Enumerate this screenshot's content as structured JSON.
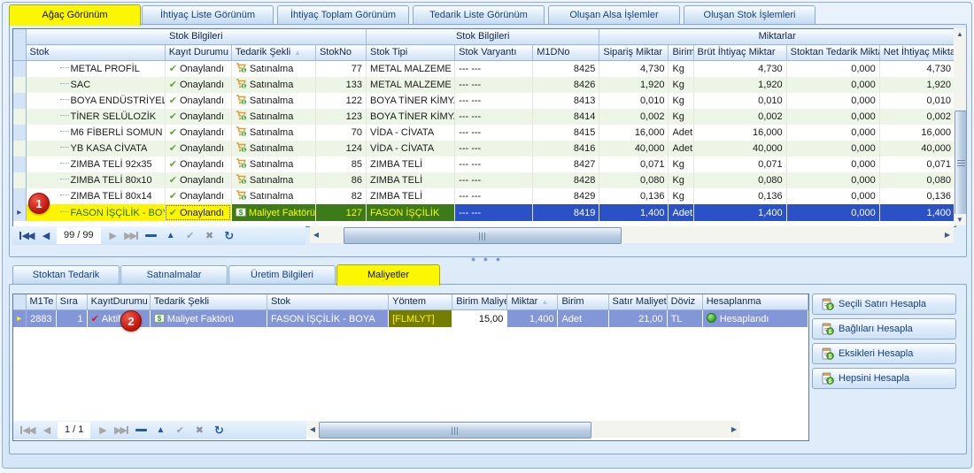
{
  "tabs_top": [
    {
      "label": "Ağaç Görünüm",
      "active": true
    },
    {
      "label": "İhtiyaç Liste Görünüm",
      "active": false
    },
    {
      "label": "İhtiyaç Toplam Görünüm",
      "active": false
    },
    {
      "label": "Tedarik Liste Görünüm",
      "active": false
    },
    {
      "label": "Oluşan Alsa İşlemler",
      "active": false
    },
    {
      "label": "Oluşan Stok İşlemleri",
      "active": false
    }
  ],
  "main_grid": {
    "bands": [
      "Stok Bilgileri",
      "Stok Bilgileri",
      "Miktarlar"
    ],
    "columns": [
      {
        "label": "Stok"
      },
      {
        "label": "Kayıt Durumu"
      },
      {
        "label": "Tedarik Şekli",
        "sorted": true
      },
      {
        "label": "StokNo"
      },
      {
        "label": "Stok Tipi"
      },
      {
        "label": "Stok Varyantı"
      },
      {
        "label": "M1DNo"
      },
      {
        "label": "Sipariş Miktar"
      },
      {
        "label": "Birim"
      },
      {
        "label": "Brüt İhtiyaç Miktar"
      },
      {
        "label": "Stoktan Tedarik Miktar"
      },
      {
        "label": "Net İhtiyaç Miktar"
      }
    ],
    "rows": [
      {
        "stok": "METAL PROFİL",
        "kayit": "Onaylandı",
        "tedarik": "Satınalma",
        "tedarik_icon": "cart",
        "stokno": "77",
        "tip": "METAL MALZEME",
        "varyant": "--- ---",
        "m1dno": "8425",
        "siparis": "4,730",
        "birim": "Kg",
        "brut": "4,730",
        "stoktan": "0,000",
        "net": "4,730",
        "selected": false
      },
      {
        "stok": "SAC",
        "kayit": "Onaylandı",
        "tedarik": "Satınalma",
        "tedarik_icon": "cart",
        "stokno": "133",
        "tip": "METAL MALZEME",
        "varyant": "--- ---",
        "m1dno": "8426",
        "siparis": "1,920",
        "birim": "Kg",
        "brut": "1,920",
        "stoktan": "0,000",
        "net": "1,920",
        "selected": false
      },
      {
        "stok": "BOYA ENDÜSTRİYEL GR",
        "kayit": "Onaylandı",
        "tedarik": "Satınalma",
        "tedarik_icon": "cart",
        "stokno": "122",
        "tip": "BOYA TİNER KİMYA",
        "varyant": "--- ---",
        "m1dno": "8413",
        "siparis": "0,010",
        "birim": "Kg",
        "brut": "0,010",
        "stoktan": "0,000",
        "net": "0,010",
        "selected": false
      },
      {
        "stok": "TİNER SELÜLOZİK",
        "kayit": "Onaylandı",
        "tedarik": "Satınalma",
        "tedarik_icon": "cart",
        "stokno": "123",
        "tip": "BOYA TİNER KİMYA",
        "varyant": "--- ---",
        "m1dno": "8414",
        "siparis": "0,002",
        "birim": "Kg",
        "brut": "0,002",
        "stoktan": "0,000",
        "net": "0,002",
        "selected": false
      },
      {
        "stok": "M6 FİBERLİ SOMUN",
        "kayit": "Onaylandı",
        "tedarik": "Satınalma",
        "tedarik_icon": "cart",
        "stokno": "70",
        "tip": "VİDA - CİVATA",
        "varyant": "--- ---",
        "m1dno": "8415",
        "siparis": "16,000",
        "birim": "Adet",
        "brut": "16,000",
        "stoktan": "0,000",
        "net": "16,000",
        "selected": false
      },
      {
        "stok": "YB KASA CİVATA",
        "kayit": "Onaylandı",
        "tedarik": "Satınalma",
        "tedarik_icon": "cart",
        "stokno": "124",
        "tip": "VİDA - CİVATA",
        "varyant": "--- ---",
        "m1dno": "8416",
        "siparis": "40,000",
        "birim": "Adet",
        "brut": "40,000",
        "stoktan": "0,000",
        "net": "40,000",
        "selected": false
      },
      {
        "stok": "ZIMBA TELİ 92x35",
        "kayit": "Onaylandı",
        "tedarik": "Satınalma",
        "tedarik_icon": "cart",
        "stokno": "85",
        "tip": "ZIMBA TELİ",
        "varyant": "--- ---",
        "m1dno": "8427",
        "siparis": "0,071",
        "birim": "Kg",
        "brut": "0,071",
        "stoktan": "0,000",
        "net": "0,071",
        "selected": false
      },
      {
        "stok": "ZIMBA TELİ 80x10",
        "kayit": "Onaylandı",
        "tedarik": "Satınalma",
        "tedarik_icon": "cart",
        "stokno": "86",
        "tip": "ZIMBA TELİ",
        "varyant": "--- ---",
        "m1dno": "8428",
        "siparis": "0,080",
        "birim": "Kg",
        "brut": "0,080",
        "stoktan": "0,000",
        "net": "0,080",
        "selected": false
      },
      {
        "stok": "ZIMBA TELİ 80x14",
        "kayit": "Onaylandı",
        "tedarik": "Satınalma",
        "tedarik_icon": "cart",
        "stokno": "82",
        "tip": "ZIMBA TELİ",
        "varyant": "--- ---",
        "m1dno": "8429",
        "siparis": "0,136",
        "birim": "Kg",
        "brut": "0,136",
        "stoktan": "0,000",
        "net": "0,136",
        "selected": false
      },
      {
        "stok": "FASON İŞÇİLİK - BOYA",
        "kayit": "Onaylandı",
        "tedarik": "Maliyet Faktörü",
        "tedarik_icon": "money",
        "stokno": "127",
        "tip": "FASON İŞÇİLİK",
        "varyant": "--- ---",
        "m1dno": "8419",
        "siparis": "1,400",
        "birim": "Adet",
        "brut": "1,400",
        "stoktan": "0,000",
        "net": "1,400",
        "selected": true
      }
    ],
    "navigator": {
      "counter": "99 / 99"
    }
  },
  "bottom": {
    "tabs": [
      {
        "label": "Stoktan Tedarik",
        "active": false
      },
      {
        "label": "Satınalmalar",
        "active": false
      },
      {
        "label": "Üretim Bilgileri",
        "active": false
      },
      {
        "label": "Maliyetler",
        "active": true
      }
    ],
    "grid": {
      "columns": [
        {
          "label": "M1Te"
        },
        {
          "label": "Sıra"
        },
        {
          "label": "KayıtDurumu"
        },
        {
          "label": "Tedarik Şekli"
        },
        {
          "label": "Stok"
        },
        {
          "label": "Yöntem"
        },
        {
          "label": "Birim Maliyet"
        },
        {
          "label": "Miktar",
          "sorted": true
        },
        {
          "label": "Birim"
        },
        {
          "label": "Satır Maliyet"
        },
        {
          "label": "Döviz"
        },
        {
          "label": "Hesaplanma"
        }
      ],
      "row": {
        "m1te": "2883",
        "sira": "1",
        "kayit": "Aktif",
        "tedarik": "Maliyet Faktörü",
        "stok": "FASON İŞÇİLİK - BOYA",
        "yontem": "[FLMLYT]",
        "birim_maliyet": "15,00",
        "miktar": "1,400",
        "birim": "Adet",
        "satir_maliyet": "21,00",
        "doviz": "TL",
        "hesaplanma": "Hesaplandı"
      }
    },
    "buttons": [
      "Seçili Satırı Hesapla",
      "Bağlıları Hesapla",
      "Eksikleri Hesapla",
      "Hepsini Hesapla"
    ],
    "navigator": {
      "counter": "1 / 1"
    }
  },
  "badges": {
    "one": "1",
    "two": "2"
  },
  "colors": {
    "active_tab": "#fbf602",
    "selection_blue": "#2a52c6",
    "selection_green": "#3d7a1a",
    "selection_yellow": "#fcf500",
    "bottom_selection": "#8296d8",
    "olive_cell": "#757d00",
    "row_alt": "#edf5e7",
    "badge_red": "#c01408"
  }
}
